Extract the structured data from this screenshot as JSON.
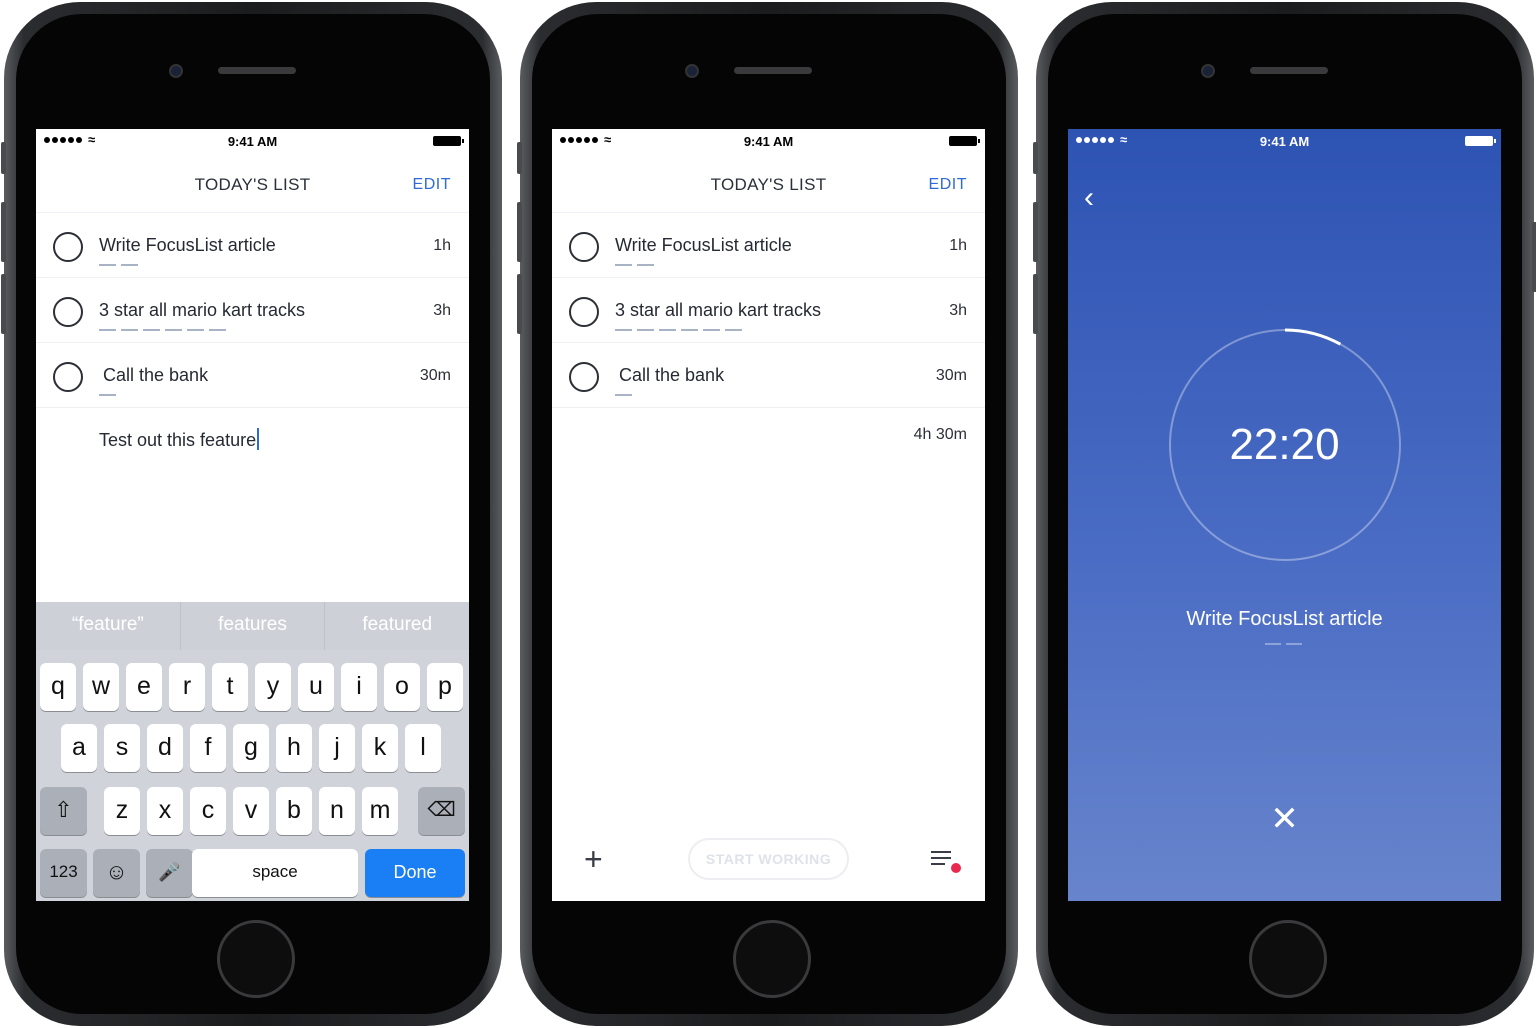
{
  "status": {
    "time": "9:41 AM"
  },
  "list": {
    "title": "TODAY'S LIST",
    "edit_label": "EDIT"
  },
  "tasks": [
    {
      "label": "Write FocusList article",
      "duration": "1h"
    },
    {
      "label": "3 star all mario kart tracks",
      "duration": "3h"
    },
    {
      "label": "Call the bank",
      "duration": "30m"
    }
  ],
  "new_task": {
    "value": "Test out this feature"
  },
  "total": "4h 30m",
  "keyboard": {
    "suggestions": [
      "“feature”",
      "features",
      "featured"
    ],
    "row1": [
      "q",
      "w",
      "e",
      "r",
      "t",
      "y",
      "u",
      "i",
      "o",
      "p"
    ],
    "row2": [
      "a",
      "s",
      "d",
      "f",
      "g",
      "h",
      "j",
      "k",
      "l"
    ],
    "row3": [
      "z",
      "x",
      "c",
      "v",
      "b",
      "n",
      "m"
    ],
    "numbers_label": "123",
    "space_label": "space",
    "done_label": "Done"
  },
  "actions": {
    "start_label": "START WORKING"
  },
  "focus": {
    "timer": "22:20",
    "task": "Write FocusList article",
    "progress_fraction": 0.08
  },
  "icons": {
    "checkbox": "circle-outline-icon",
    "back": "chevron-left-icon",
    "close": "close-icon",
    "add": "plus-icon",
    "menu": "list-menu-icon",
    "shift": "shift-icon",
    "delete": "backspace-icon",
    "emoji": "emoji-icon",
    "mic": "microphone-icon"
  },
  "colors": {
    "accent": "#2f6ad9",
    "done_key": "#1a7ff5",
    "focus_bg": "#3d5fbd",
    "badge": "#e9284e"
  }
}
